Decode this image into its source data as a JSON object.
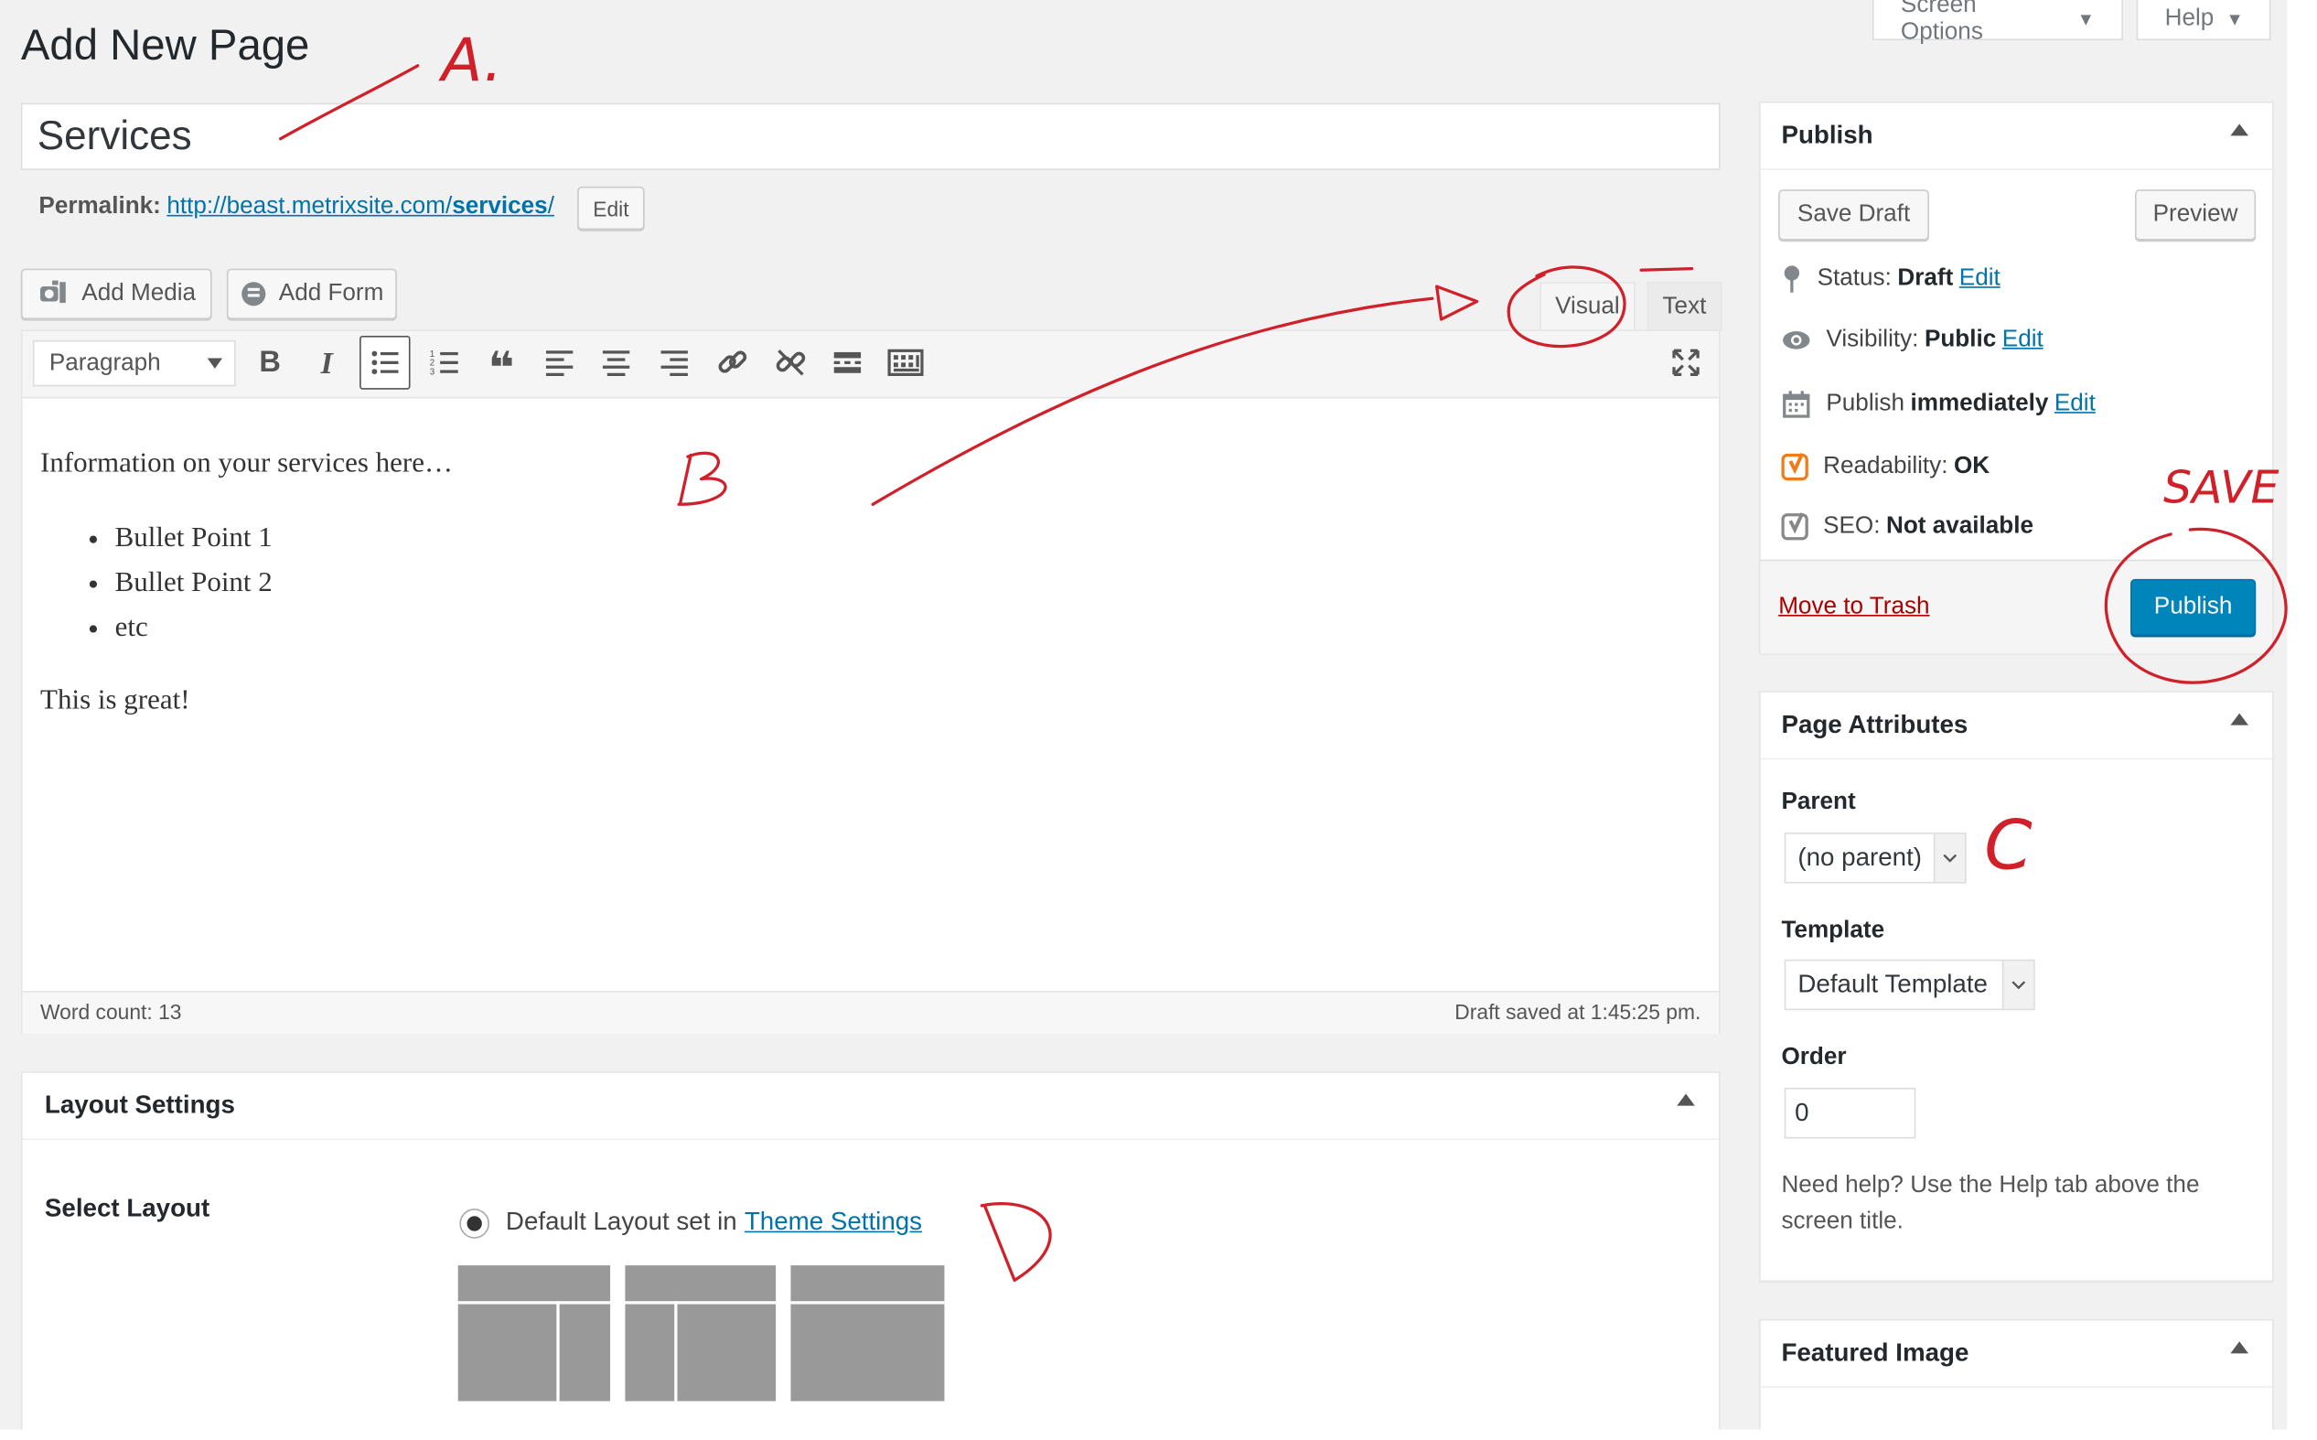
{
  "screen_options": {
    "label": "Screen Options",
    "arrow": "▼"
  },
  "help": {
    "label": "Help",
    "arrow": "▼"
  },
  "page_title": "Add New Page",
  "post_title": {
    "value": "Services"
  },
  "permalink": {
    "label": "Permalink:",
    "url_prefix": "http://beast.metrixsite.com/",
    "url_slug": "services",
    "url_suffix": "/",
    "edit_label": "Edit"
  },
  "media_buttons": {
    "add_media": "Add Media",
    "add_form": "Add Form"
  },
  "editor_tabs": {
    "visual": "Visual",
    "text": "Text"
  },
  "toolbar": {
    "format_select": "Paragraph",
    "icons": [
      "bold-icon",
      "italic-icon",
      "bullet-list-icon",
      "numbered-list-icon",
      "blockquote-icon",
      "align-left-icon",
      "align-center-icon",
      "align-right-icon",
      "link-icon",
      "unlink-icon",
      "read-more-icon",
      "toolbar-toggle-icon"
    ],
    "bold_glyph": "B",
    "italic_glyph": "I",
    "quote_glyph": "❝"
  },
  "editor_content": {
    "intro": "Information on your services here…",
    "bullets": [
      "Bullet Point 1",
      "Bullet Point 2",
      "etc"
    ],
    "closing": "This is great!"
  },
  "status_bar": {
    "word_count": "Word count: 13",
    "draft_saved": "Draft saved at 1:45:25 pm."
  },
  "layout_settings": {
    "title": "Layout Settings",
    "select_label": "Select Layout",
    "option_text": "Default Layout set in",
    "option_link": "Theme Settings"
  },
  "publish_box": {
    "title": "Publish",
    "save_draft": "Save Draft",
    "preview": "Preview",
    "status_label": "Status:",
    "status_value": "Draft",
    "visibility_label": "Visibility:",
    "visibility_value": "Public",
    "publish_label": "Publish",
    "publish_value": "immediately",
    "readability_label": "Readability:",
    "readability_value": "OK",
    "seo_label": "SEO:",
    "seo_value": "Not available",
    "edit_link": "Edit",
    "move_to_trash": "Move to Trash",
    "publish_button": "Publish"
  },
  "page_attributes": {
    "title": "Page Attributes",
    "parent_label": "Parent",
    "parent_value": "(no parent)",
    "template_label": "Template",
    "template_value": "Default Template",
    "order_label": "Order",
    "order_value": "0",
    "help_text": "Need help? Use the Help tab above the screen title."
  },
  "featured_image": {
    "title": "Featured Image"
  },
  "annotations": {
    "color": "#d0202a",
    "letter_a": "A.",
    "letter_c": "C",
    "letter_save": "SAVE"
  },
  "colors": {
    "primary_button": "#0085ba",
    "link": "#0073aa",
    "trash_link": "#a00",
    "yoast_ok": "#ee7c1b",
    "background": "#f1f1f1"
  }
}
